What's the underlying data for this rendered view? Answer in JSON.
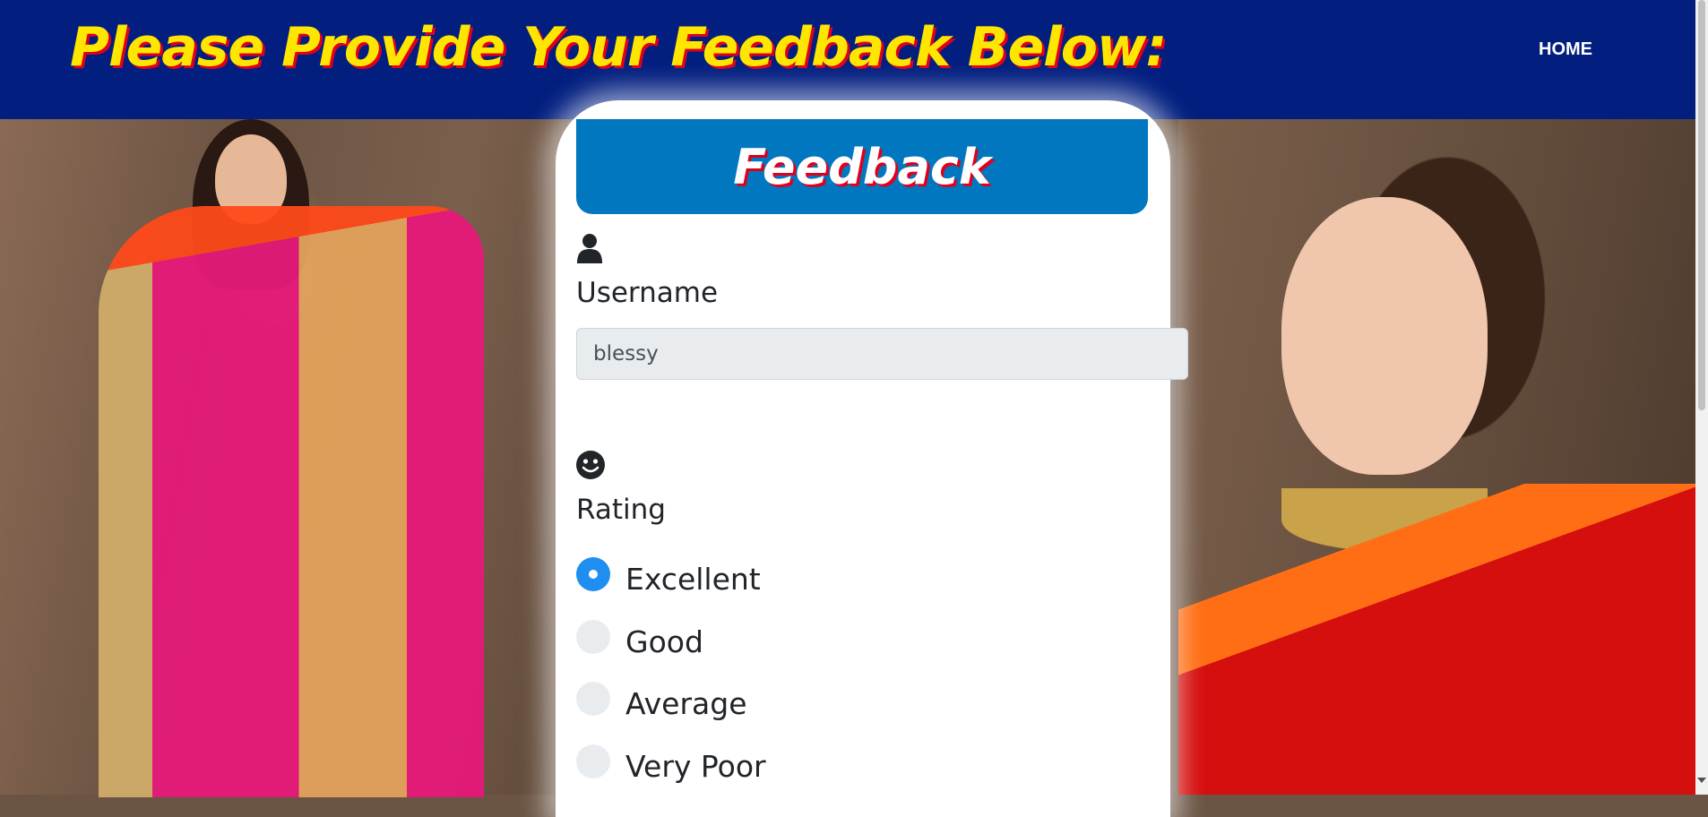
{
  "header": {
    "marquee_text": "Please Provide Your Feedback Below:",
    "nav_home": "HOME"
  },
  "card": {
    "title": "Feedback",
    "username_label": "Username",
    "username_value": "blessy",
    "rating_label": "Rating",
    "rating_options": [
      "Excellent",
      "Good",
      "Average",
      "Very Poor"
    ],
    "selected_rating": "Excellent"
  },
  "icons": {
    "user": "user-icon",
    "smile": "smile-icon"
  },
  "colors": {
    "header_bg": "#021f80",
    "marquee_text": "#ffe600",
    "marquee_shadow": "#e1001b",
    "card_header_bg": "#0077bf",
    "radio_checked": "#1e8ff0"
  }
}
